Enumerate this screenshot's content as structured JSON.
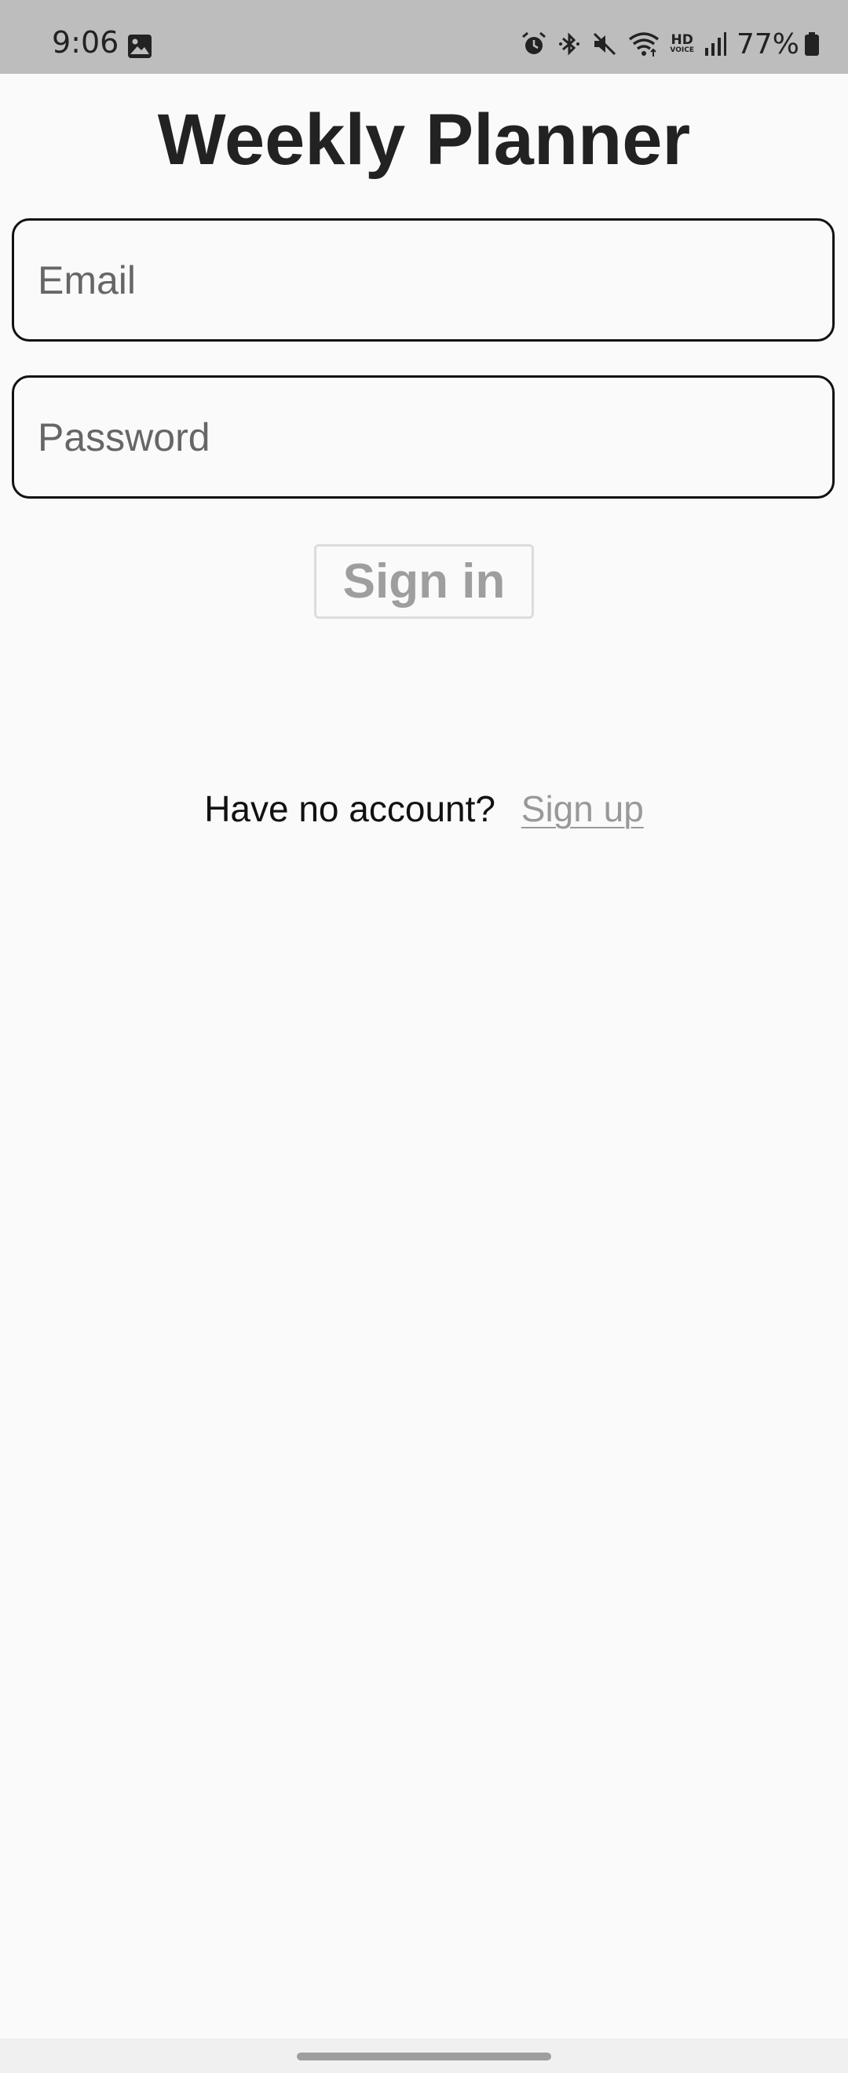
{
  "status_bar": {
    "time": "9:06",
    "left_icons": [
      "gallery-icon"
    ],
    "right_icons": [
      "alarm-icon",
      "bluetooth-icon",
      "mute-icon",
      "wifi-icon",
      "hd-voice-icon",
      "signal-icon",
      "battery-icon"
    ],
    "hd_label": "HD",
    "voice_label": "VOICE",
    "battery_percent": "77%",
    "background": "#bdbdbd"
  },
  "app": {
    "title": "Weekly Planner"
  },
  "form": {
    "email_placeholder": "Email",
    "password_placeholder": "Password",
    "sign_in_label": "Sign in"
  },
  "signup": {
    "prompt": "Have no account?",
    "link_label": "Sign up"
  },
  "colors": {
    "background": "#fafafa",
    "text": "#222222",
    "disabled_text": "#9e9e9e",
    "field_border": "#111111"
  }
}
